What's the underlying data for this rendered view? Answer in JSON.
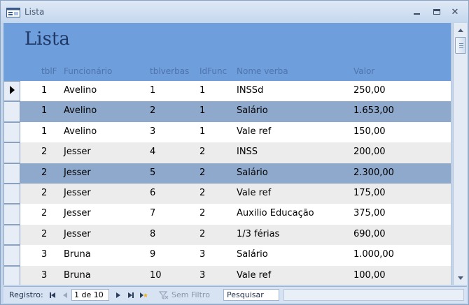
{
  "window": {
    "title": "Lista"
  },
  "form": {
    "title": "Lista"
  },
  "columns": [
    "tblF",
    "Funcionário",
    "tblverbas",
    "IdFunc",
    "Nome verba",
    "Valor"
  ],
  "rows": [
    [
      "1",
      "Avelino",
      "1",
      "1",
      "INSSd",
      "250,00"
    ],
    [
      "1",
      "Avelino",
      "2",
      "1",
      "Salário",
      "1.653,00"
    ],
    [
      "1",
      "Avelino",
      "3",
      "1",
      "Vale ref",
      "150,00"
    ],
    [
      "2",
      "Jesser",
      "4",
      "2",
      "INSS",
      "200,00"
    ],
    [
      "2",
      "Jesser",
      "5",
      "2",
      "Salário",
      "2.300,00"
    ],
    [
      "2",
      "Jesser",
      "6",
      "2",
      "Vale ref",
      "175,00"
    ],
    [
      "2",
      "Jesser",
      "7",
      "2",
      "Auxilio Educação",
      "375,00"
    ],
    [
      "2",
      "Jesser",
      "8",
      "2",
      "1/3 férias",
      "690,00"
    ],
    [
      "3",
      "Bruna",
      "9",
      "3",
      "Salário",
      "1.000,00"
    ],
    [
      "3",
      "Bruna",
      "10",
      "3",
      "Vale ref",
      "100,00"
    ]
  ],
  "row_styles": [
    "white",
    "sel-row",
    "white",
    "grey",
    "sel-row",
    "grey",
    "white",
    "grey",
    "white",
    "grey"
  ],
  "navigation": {
    "label": "Registro:",
    "record": "1 de 10",
    "filter": "Sem Filtro",
    "search": "Pesquisar"
  },
  "colors": {
    "header": "#6f9edd",
    "title": "#1f3864",
    "highlight": "#8ea9cb"
  },
  "icons": [
    "form-icon",
    "minimize-icon",
    "maximize-icon",
    "close-icon",
    "record-pointer-icon",
    "first-record-icon",
    "previous-record-icon",
    "next-record-icon",
    "last-record-icon",
    "new-record-icon",
    "filter-icon"
  ]
}
